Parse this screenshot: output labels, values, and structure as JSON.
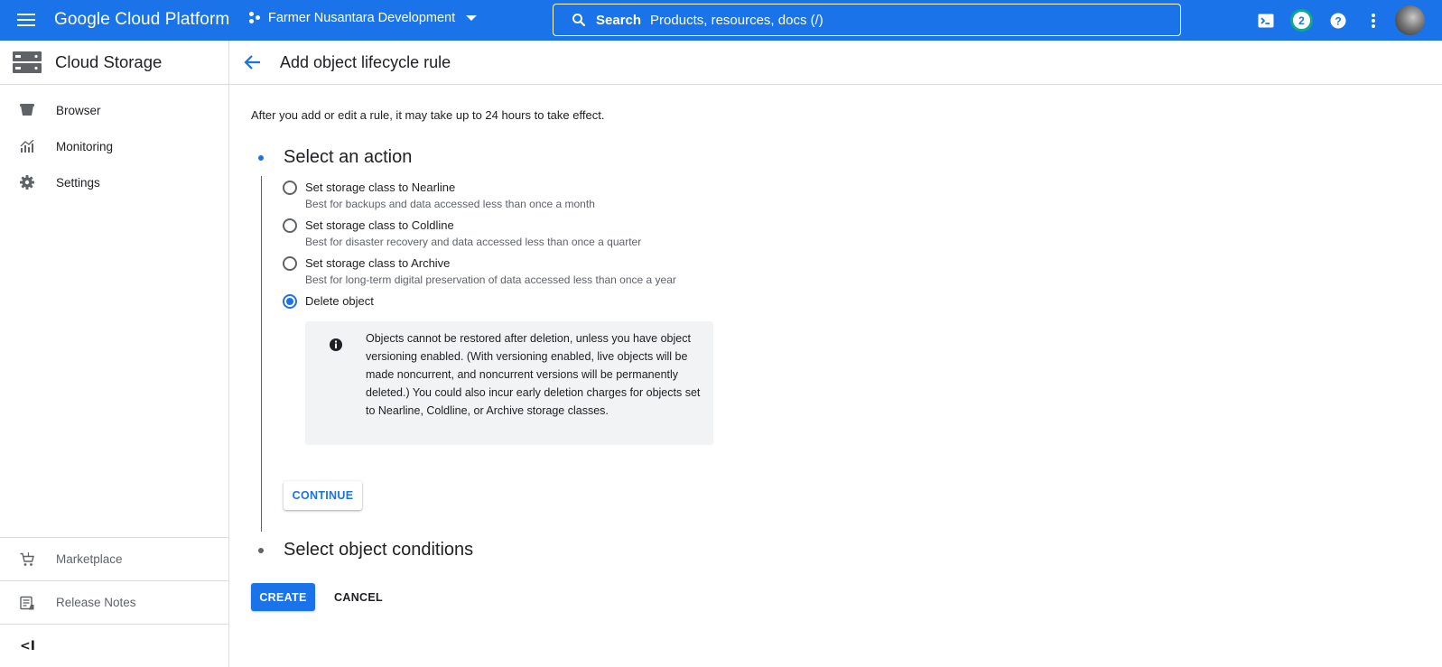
{
  "topbar": {
    "product_name": "Google Cloud Platform",
    "project_name": "Farmer Nusantara Development",
    "search_label": "Search",
    "search_placeholder": "Products, resources, docs (/)",
    "notification_count": "2"
  },
  "sidebar": {
    "title": "Cloud Storage",
    "items": [
      {
        "label": "Browser",
        "icon": "bucket-icon"
      },
      {
        "label": "Monitoring",
        "icon": "monitoring-chart-icon"
      },
      {
        "label": "Settings",
        "icon": "gear-icon"
      }
    ],
    "bottom_items": [
      {
        "label": "Marketplace",
        "icon": "cart-icon"
      },
      {
        "label": "Release Notes",
        "icon": "release-notes-icon"
      }
    ],
    "collapse_glyph": "<I"
  },
  "page": {
    "title": "Add object lifecycle rule",
    "info": "After you add or edit a rule, it may take up to 24 hours to take effect."
  },
  "steps": [
    {
      "title": "Select an action",
      "active": true
    },
    {
      "title": "Select object conditions",
      "active": false
    }
  ],
  "actions": [
    {
      "label": "Set storage class to Nearline",
      "description": "Best for backups and data accessed less than once a month",
      "checked": false
    },
    {
      "label": "Set storage class to Coldline",
      "description": "Best for disaster recovery and data accessed less than once a quarter",
      "checked": false
    },
    {
      "label": "Set storage class to Archive",
      "description": "Best for long-term digital preservation of data accessed less than once a year",
      "checked": false
    },
    {
      "label": "Delete object",
      "description": "",
      "checked": true
    }
  ],
  "warning": {
    "text": "Objects cannot be restored after deletion, unless you have object versioning enabled. (With versioning enabled, live objects will be made noncurrent, and noncurrent versions will be permanently deleted.) You could also incur early deletion charges for objects set to Nearline, Coldline, or Archive storage classes."
  },
  "buttons": {
    "continue": "CONTINUE",
    "create": "CREATE",
    "cancel": "CANCEL"
  },
  "colors": {
    "brand_blue": "#1a73e8",
    "notification_ring": "#0fa88f",
    "warning_bg": "#f1f3f4"
  }
}
